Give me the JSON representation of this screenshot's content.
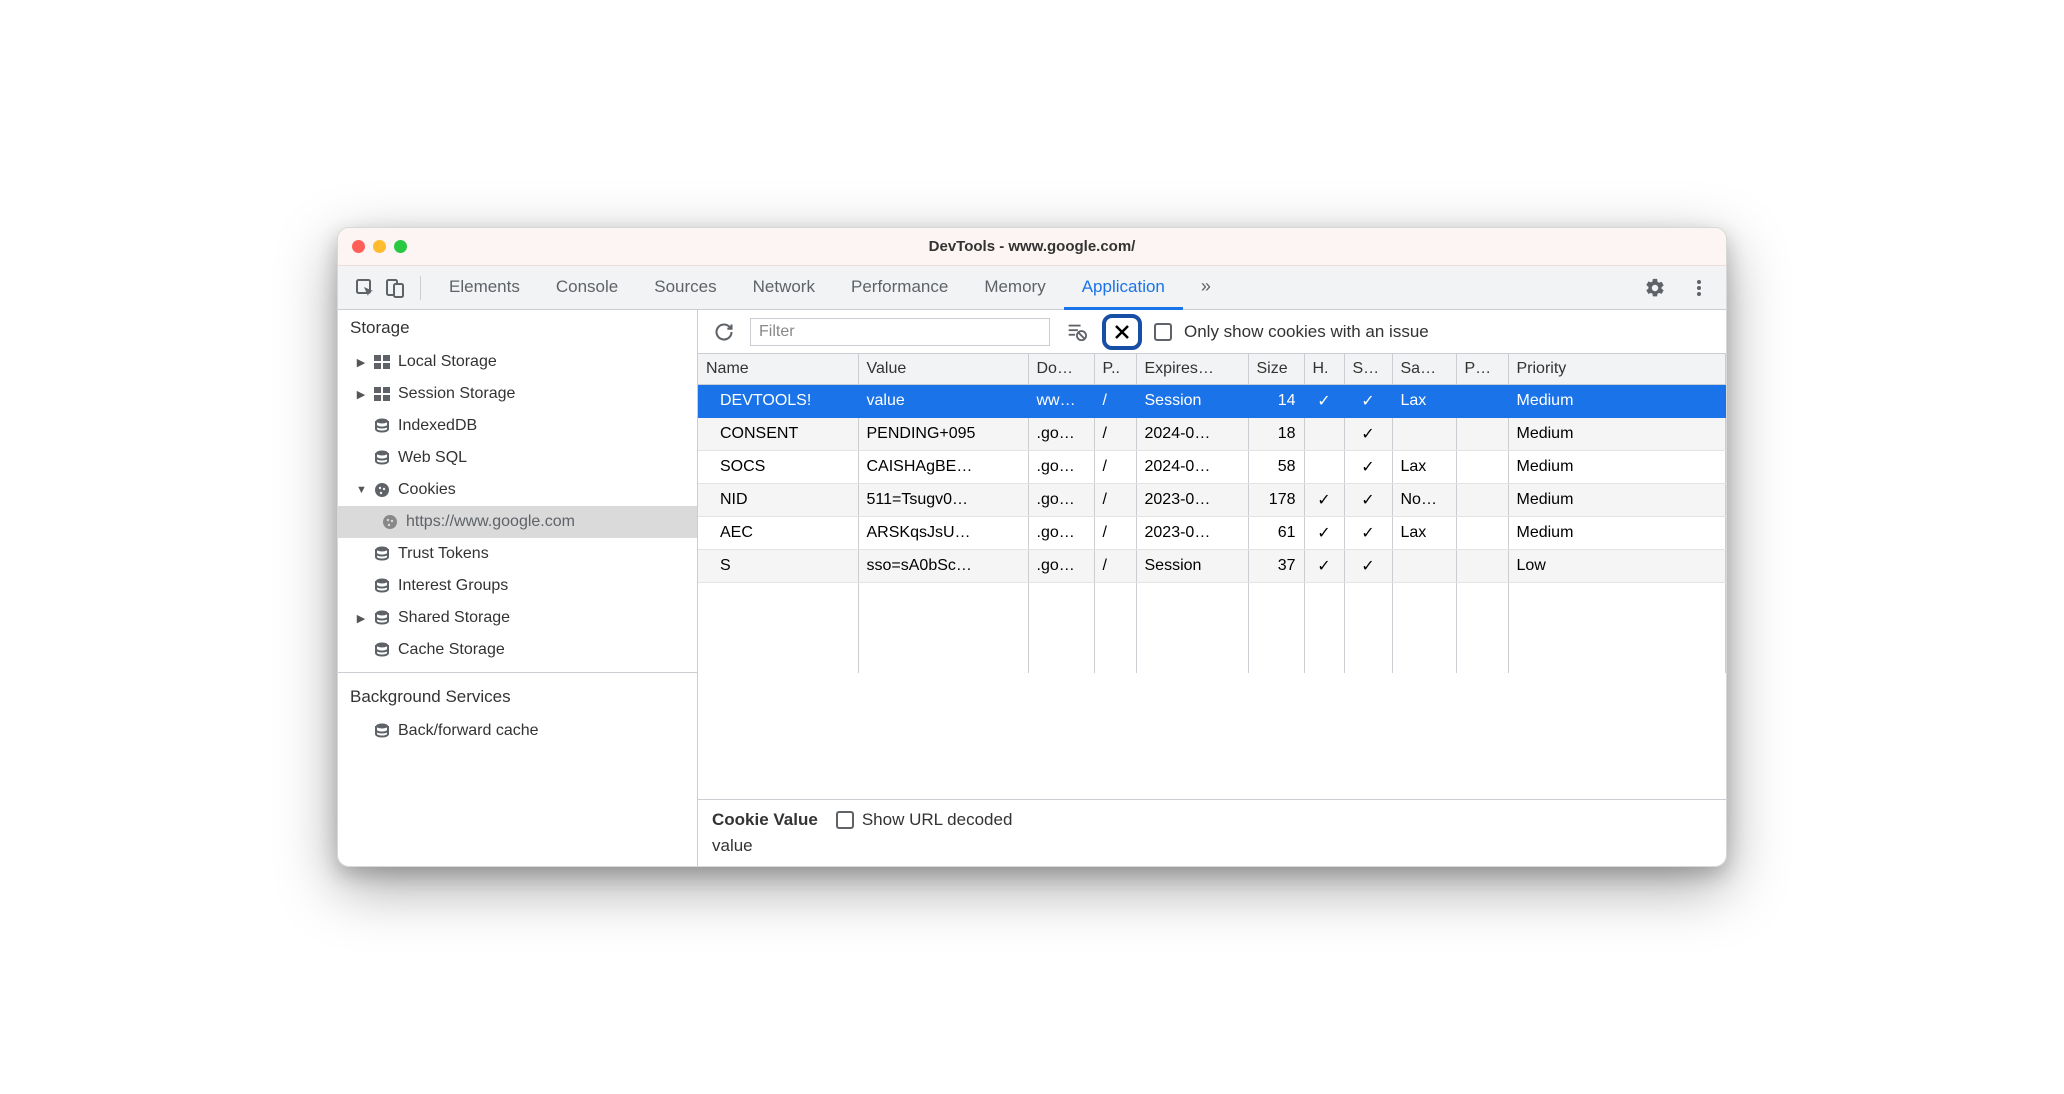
{
  "window": {
    "title": "DevTools - www.google.com/"
  },
  "tabs": {
    "items": [
      "Elements",
      "Console",
      "Sources",
      "Network",
      "Performance",
      "Memory",
      "Application"
    ],
    "active": "Application"
  },
  "sidebar": {
    "storage_heading": "Storage",
    "local_storage": "Local Storage",
    "session_storage": "Session Storage",
    "indexeddb": "IndexedDB",
    "web_sql": "Web SQL",
    "cookies": "Cookies",
    "cookies_origin": "https://www.google.com",
    "trust_tokens": "Trust Tokens",
    "interest_groups": "Interest Groups",
    "shared_storage": "Shared Storage",
    "cache_storage": "Cache Storage",
    "background_heading": "Background Services",
    "bf_cache": "Back/forward cache"
  },
  "toolbar": {
    "filter_placeholder": "Filter",
    "only_issues_label": "Only show cookies with an issue"
  },
  "table": {
    "headers": [
      "Name",
      "Value",
      "Do…",
      "P..",
      "Expires…",
      "Size",
      "H.",
      "S…",
      "Sa…",
      "P…",
      "Priority"
    ],
    "rows": [
      {
        "name": "DEVTOOLS!",
        "value": "value",
        "domain": "ww…",
        "path": "/",
        "expires": "Session",
        "size": "14",
        "http": "✓",
        "secure": "✓",
        "samesite": "Lax",
        "partition": "",
        "priority": "Medium",
        "selected": true
      },
      {
        "name": "CONSENT",
        "value": "PENDING+095",
        "domain": ".go…",
        "path": "/",
        "expires": "2024-0…",
        "size": "18",
        "http": "",
        "secure": "✓",
        "samesite": "",
        "partition": "",
        "priority": "Medium"
      },
      {
        "name": "SOCS",
        "value": "CAISHAgBE…",
        "domain": ".go…",
        "path": "/",
        "expires": "2024-0…",
        "size": "58",
        "http": "",
        "secure": "✓",
        "samesite": "Lax",
        "partition": "",
        "priority": "Medium"
      },
      {
        "name": "NID",
        "value": "511=Tsugv0…",
        "domain": ".go…",
        "path": "/",
        "expires": "2023-0…",
        "size": "178",
        "http": "✓",
        "secure": "✓",
        "samesite": "No…",
        "partition": "",
        "priority": "Medium"
      },
      {
        "name": "AEC",
        "value": "ARSKqsJsU…",
        "domain": ".go…",
        "path": "/",
        "expires": "2023-0…",
        "size": "61",
        "http": "✓",
        "secure": "✓",
        "samesite": "Lax",
        "partition": "",
        "priority": "Medium"
      },
      {
        "name": "S",
        "value": "sso=sA0bSc…",
        "domain": ".go…",
        "path": "/",
        "expires": "Session",
        "size": "37",
        "http": "✓",
        "secure": "✓",
        "samesite": "",
        "partition": "",
        "priority": "Low"
      }
    ]
  },
  "detail": {
    "label": "Cookie Value",
    "show_decoded": "Show URL decoded",
    "value": "value"
  }
}
